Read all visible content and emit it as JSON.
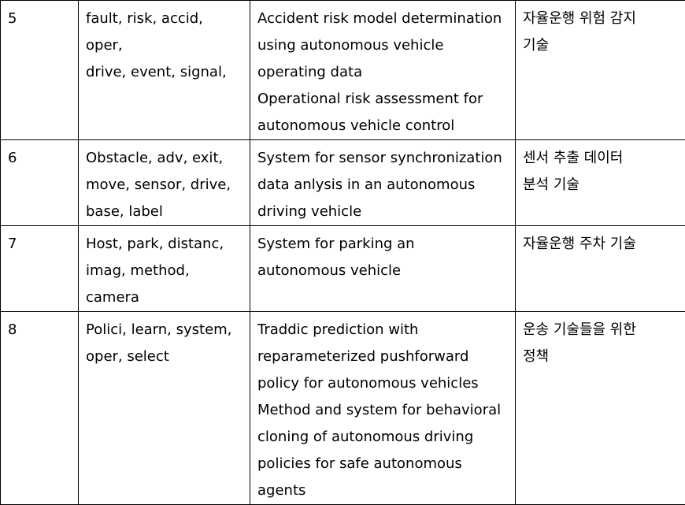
{
  "rows": [
    {
      "num": "5",
      "keywords": "fault, risk, accid, oper,\ndrive, event, signal,",
      "titles": "Accident risk model determination\nusing autonomous vehicle\noperating data\nOperational risk assessment for\nautonomous vehicle control",
      "korean": "자율운행  위험  감지\n기술"
    },
    {
      "num": "6",
      "keywords": "Obstacle, adv, exit,\nmove, sensor, drive,\nbase, label",
      "titles": "System for sensor synchronization\ndata anlysis in an autonomous\ndriving vehicle",
      "korean": "센서 추출 데이터\n분석 기술"
    },
    {
      "num": "7",
      "keywords": "Host, park, distanc,\nimag, method,\ncamera",
      "titles": "System for parking an\nautonomous vehicle",
      "korean": "자율운행 주차 기술"
    },
    {
      "num": "8",
      "keywords": "Polici, learn, system,\noper, select",
      "titles": "Traddic prediction with\nreparameterized pushforward\npolicy for autonomous vehicles\nMethod and system for behavioral\ncloning of autonomous driving\npolicies for safe autonomous\nagents",
      "korean": "운송  기술들을  위한\n정책"
    }
  ]
}
